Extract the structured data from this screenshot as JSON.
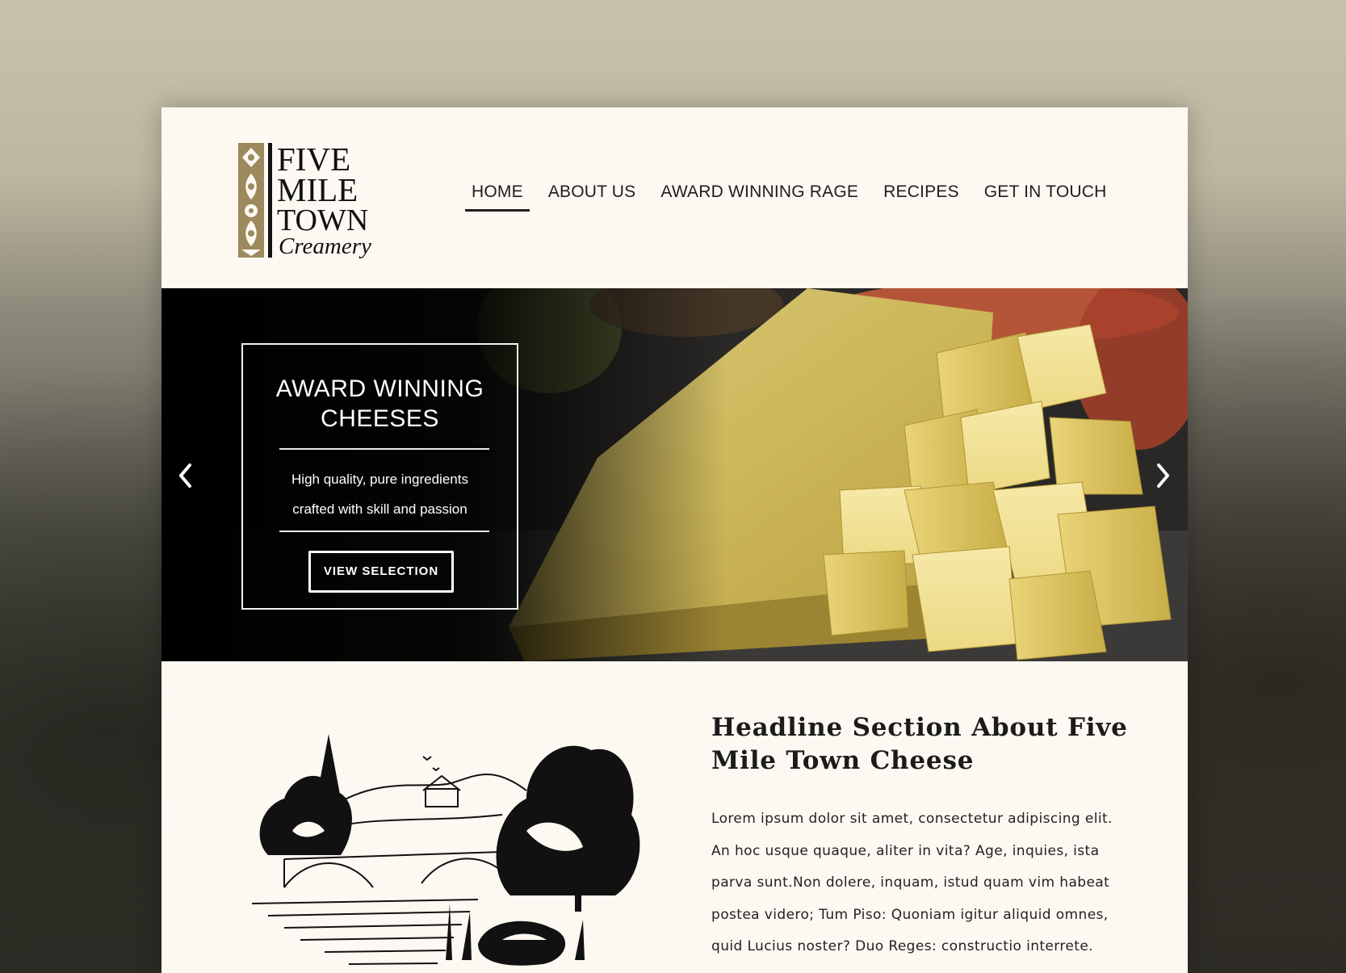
{
  "logo": {
    "line1": "FIVE",
    "line2": "MILE",
    "line3": "TOWN",
    "line4": "Creamery"
  },
  "nav": {
    "items": [
      {
        "label": "HOME",
        "active": true
      },
      {
        "label": "ABOUT US",
        "active": false
      },
      {
        "label": "AWARD WINNING RAGE",
        "active": false
      },
      {
        "label": "RECIPES",
        "active": false
      },
      {
        "label": "GET IN TOUCH",
        "active": false
      }
    ]
  },
  "hero": {
    "title_line1": "AWARD WINNING",
    "title_line2": "CHEESES",
    "text_line1": "High quality, pure ingredients",
    "text_line2": "crafted with skill and passion",
    "button_label": "VIEW SELECTION",
    "prev_icon": "chevron-left-icon",
    "next_icon": "chevron-right-icon"
  },
  "about": {
    "headline": "Headline Section About Five Mile Town Cheese",
    "body": "Lorem ipsum dolor sit amet, consectetur adipiscing  elit. An hoc usque quaque, aliter in vita? Age, inquies, ista parva sunt.Non dolere, inquam, istud quam vim habeat postea videro; Tum Piso: Quoniam igitur aliquid omnes, quid Lucius noster? Duo Reges: constructio interrete."
  },
  "colors": {
    "page_bg": "#fdf8f1",
    "accent_gold": "#9c8a5e",
    "text_dark": "#1e1e1e"
  }
}
